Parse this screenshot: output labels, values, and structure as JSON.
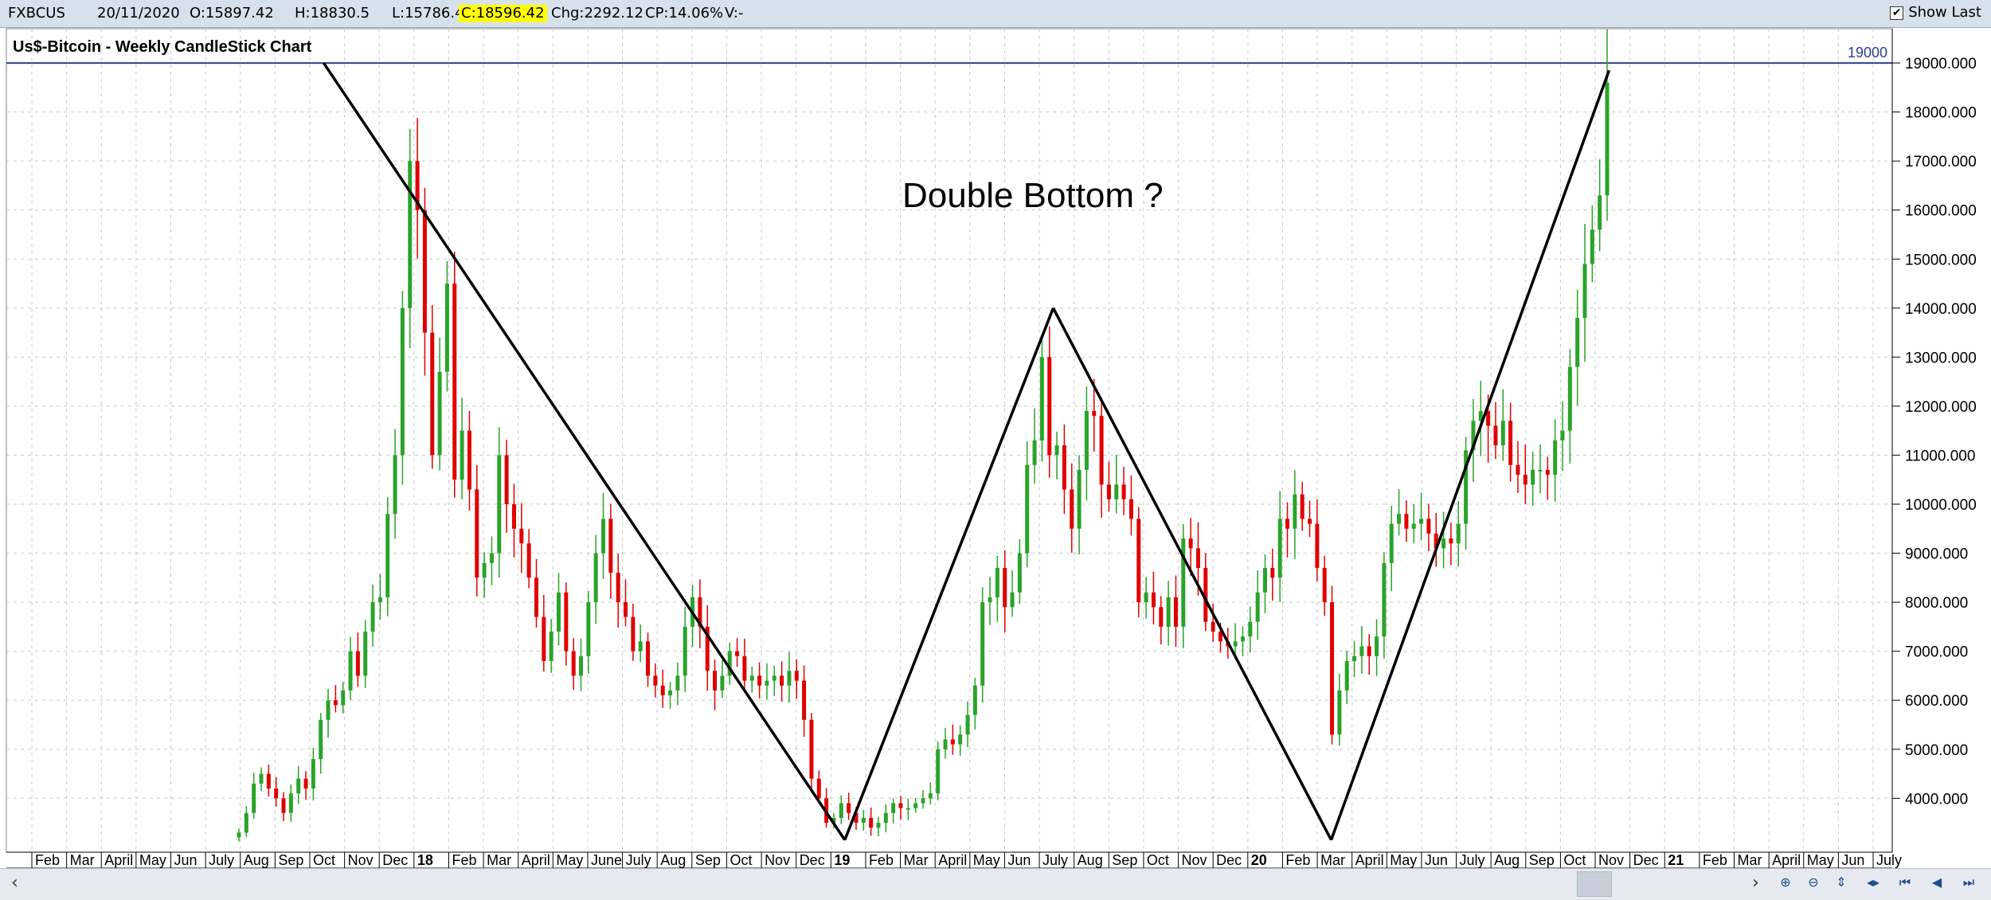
{
  "header": {
    "symbol": "FXBCUS",
    "date": "20/11/2020",
    "open": "O:15897.42",
    "high": "H:18830.5",
    "low": "L:15786.46",
    "close": "C:18596.42",
    "change": "Chg:2292.12",
    "change_pct": "CP:14.06%",
    "volume": "V:-",
    "show_last_label": "Show Last",
    "show_last_checked": "✔"
  },
  "chart_data": {
    "type": "candlestick",
    "title": "Us$-Bitcoin - Weekly CandleStick Chart",
    "annotation": "Double Bottom ?",
    "ylim": [
      2900,
      19700
    ],
    "y_ticks": [
      4000,
      5000,
      6000,
      7000,
      8000,
      9000,
      10000,
      11000,
      12000,
      13000,
      14000,
      15000,
      16000,
      17000,
      18000,
      19000
    ],
    "y_tick_labels": [
      "4000.000",
      "5000.000",
      "6000.000",
      "7000.000",
      "8000.000",
      "9000.000",
      "10000.000",
      "11000.000",
      "12000.000",
      "13000.000",
      "14000.000",
      "15000.000",
      "16000.000",
      "17000.000",
      "18000.000",
      "19000.000"
    ],
    "horizontal_line": {
      "value": 19000,
      "label": "19000"
    },
    "x_labels": [
      "Feb",
      "Mar",
      "April",
      "May",
      "Jun",
      "July",
      "Aug",
      "Sep",
      "Oct",
      "Nov",
      "Dec",
      "18",
      "Feb",
      "Mar",
      "April",
      "May",
      "June",
      "July",
      "Aug",
      "Sep",
      "Oct",
      "Nov",
      "Dec",
      "19",
      "Feb",
      "Mar",
      "April",
      "May",
      "Jun",
      "July",
      "Aug",
      "Sep",
      "Oct",
      "Nov",
      "Dec",
      "20",
      "Feb",
      "Mar",
      "April",
      "May",
      "Jun",
      "July",
      "Aug",
      "Sep",
      "Oct",
      "Nov",
      "Dec",
      "21",
      "Feb",
      "Mar",
      "April",
      "May",
      "Jun",
      "July"
    ],
    "candles_weekly_close_est": [
      3300,
      3700,
      4300,
      4500,
      4200,
      4000,
      3700,
      4100,
      4400,
      4200,
      4800,
      5600,
      6000,
      5900,
      6200,
      7000,
      6500,
      7400,
      8000,
      8100,
      9800,
      11000,
      14000,
      17000,
      16000,
      13500,
      11000,
      12700,
      14500,
      10500,
      11500,
      10300,
      8500,
      8800,
      9000,
      11000,
      10000,
      9500,
      9200,
      8500,
      7700,
      6800,
      7400,
      8200,
      7000,
      6500,
      6900,
      8000,
      9000,
      9700,
      8600,
      8000,
      7700,
      7000,
      7200,
      6500,
      6300,
      6100,
      6200,
      6500,
      7500,
      8100,
      7500,
      6600,
      6200,
      6500,
      7000,
      6900,
      6400,
      6500,
      6300,
      6400,
      6500,
      6300,
      6600,
      6400,
      5600,
      4400,
      4000,
      3500,
      3600,
      3900,
      3700,
      3500,
      3600,
      3400,
      3500,
      3700,
      3900,
      3800,
      3800,
      3900,
      4000,
      4100,
      5000,
      5200,
      5100,
      5300,
      5700,
      6300,
      8000,
      8100,
      8700,
      7900,
      8200,
      9000,
      10800,
      11300,
      13000,
      11000,
      11200,
      10300,
      9500,
      10700,
      11900,
      11800,
      10400,
      10100,
      10400,
      10100,
      9700,
      8000,
      8200,
      7900,
      7500,
      8100,
      7500,
      9300,
      9100,
      8700,
      7600,
      7400,
      7200,
      7100,
      7200,
      7300,
      7600,
      8200,
      8700,
      8500,
      9700,
      9500,
      10200,
      9700,
      9600,
      8700,
      8000,
      5300,
      6200,
      6800,
      6900,
      7100,
      6900,
      7300,
      8800,
      9600,
      9800,
      9500,
      9600,
      9700,
      9400,
      9100,
      9300,
      9200,
      9600,
      11100,
      11700,
      11900,
      11600,
      11200,
      11700,
      10800,
      10600,
      10400,
      10700,
      10700,
      10600,
      11300,
      11500,
      12800,
      13800,
      14900,
      15600,
      16300,
      18600
    ],
    "trend_lines": [
      {
        "name": "",
        "points": [
          [
            "2017-10",
            19000
          ],
          [
            "2019-01",
            3150
          ]
        ]
      },
      {
        "name": "",
        "points": [
          [
            "2019-01",
            3150
          ],
          [
            "2019-07",
            14000
          ]
        ]
      },
      {
        "name": "",
        "points": [
          [
            "2019-07",
            14000
          ],
          [
            "2020-03",
            3150
          ]
        ]
      },
      {
        "name": "",
        "points": [
          [
            "2020-03",
            3150
          ],
          [
            "2020-11",
            18850
          ]
        ]
      }
    ],
    "colors": {
      "up": "#2aa32a",
      "down": "#e00000",
      "grid": "#c8c8c8",
      "line": "#000000",
      "hline": "#2c3e8c"
    },
    "grid": true
  }
}
